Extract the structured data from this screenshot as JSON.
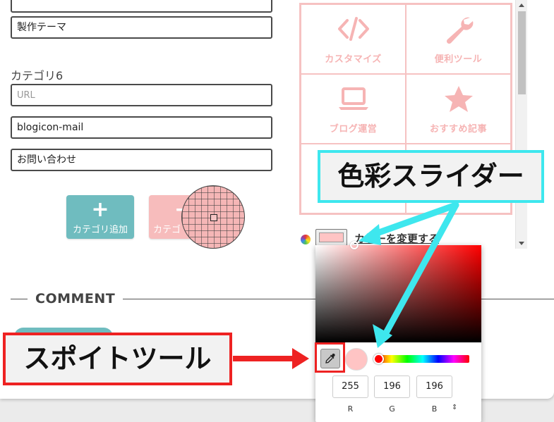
{
  "form": {
    "theme_value": "製作テーマ",
    "category_label": "カテゴリ6",
    "url_placeholder": "URL",
    "icon_value": "blogicon-mail",
    "name_value": "お問い合わせ",
    "add_button": {
      "icon": "plus-icon",
      "label": "カテゴリ追加"
    },
    "delete_button": {
      "icon": "minus-icon",
      "label": "カテゴ"
    }
  },
  "comment": {
    "title": "COMMENT"
  },
  "menu_grid": {
    "accent_color": "#f6b4b4",
    "items": [
      {
        "icon": "code-icon",
        "label": "カスタマイズ"
      },
      {
        "icon": "wrench-icon",
        "label": "便利ツール"
      },
      {
        "icon": "laptop-icon",
        "label": "ブログ運営"
      },
      {
        "icon": "star-icon",
        "label": "おすすめ記事"
      }
    ]
  },
  "color_control": {
    "icon": "palette-icon",
    "current_color": "#ffc4c4",
    "change_label": "カラーを変更する"
  },
  "color_picker": {
    "hue_color": "#ff0000",
    "preview_color": "#ffc4c4",
    "eyedropper_icon": "eyedropper-icon",
    "r": "255",
    "g": "196",
    "b": "196",
    "r_label": "R",
    "g_label": "G",
    "b_label": "B",
    "mode_toggle": "⇕"
  },
  "annotations": {
    "slider_callout": {
      "text": "色彩スライダー",
      "border_color": "#3ee7ee"
    },
    "eyedropper_callout": {
      "text": "スポイトツール",
      "border_color": "#ee2222"
    }
  }
}
